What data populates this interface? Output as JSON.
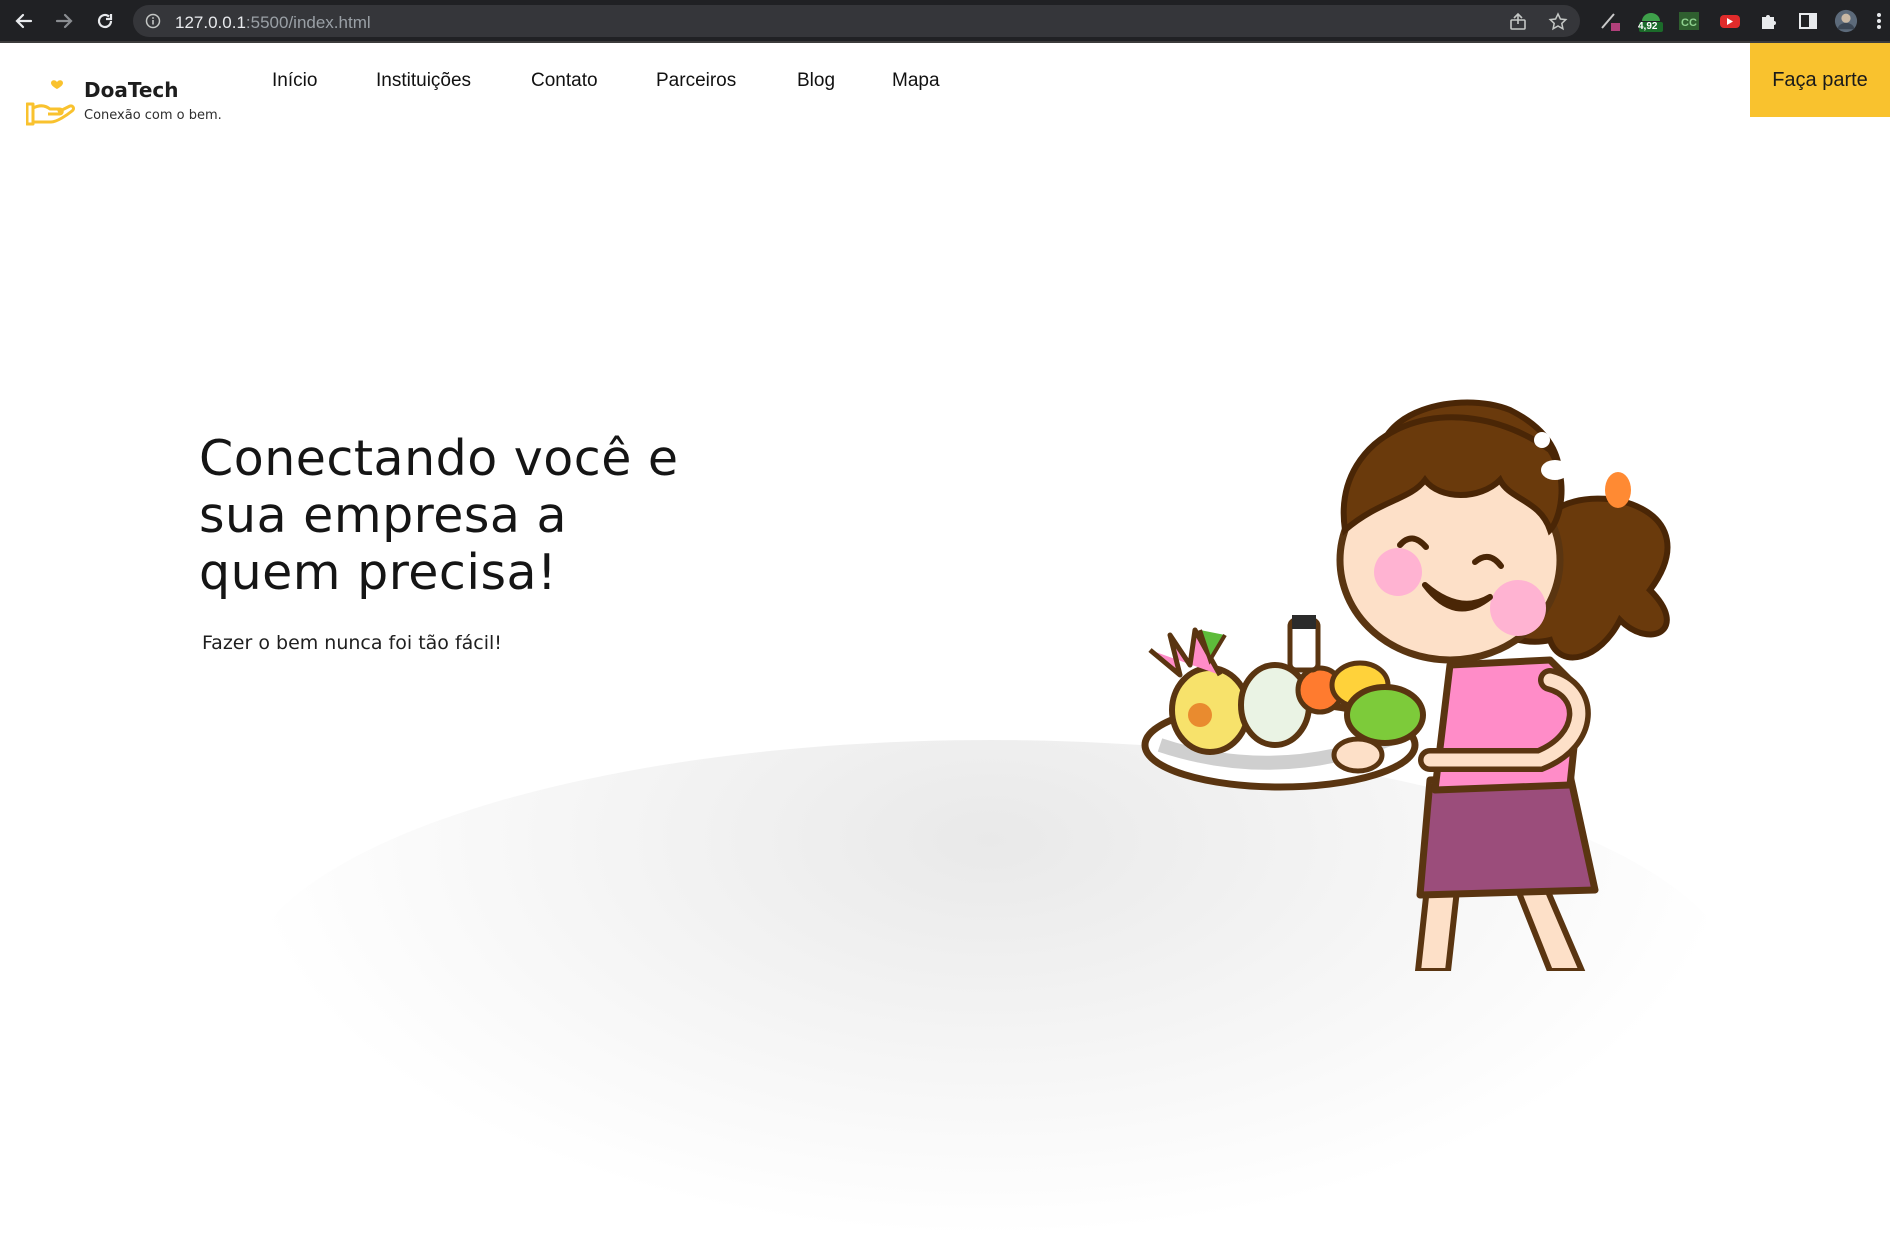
{
  "browser": {
    "url_host": "127.0.0.1",
    "url_path": ":5500/index.html",
    "extension_badge": "4,92"
  },
  "site": {
    "logo_name": "DoaTech",
    "logo_tagline": "Conexão com o bem.",
    "nav": [
      "Início",
      "Instituições",
      "Contato",
      "Parceiros",
      "Blog",
      "Mapa"
    ],
    "cta_label": "Faça parte"
  },
  "hero": {
    "title_lines": [
      "Conectando você e",
      "sua empresa a",
      "quem precisa!"
    ],
    "subtitle": "Fazer o bem nunca foi tão fácil!"
  },
  "colors": {
    "accent": "#f9c22e",
    "chrome_bg": "#202124",
    "text": "#151515"
  },
  "icons": [
    "back-arrow-icon",
    "forward-arrow-icon",
    "reload-icon",
    "info-icon",
    "share-icon",
    "star-icon",
    "puzzle-icon",
    "sidebar-icon",
    "kebab-menu-icon"
  ]
}
